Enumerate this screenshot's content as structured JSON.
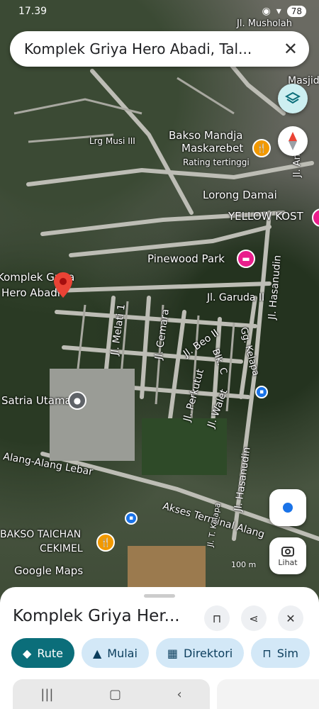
{
  "status": {
    "time": "17.39",
    "battery": "78"
  },
  "search": {
    "query": "Komplek Griya Hero Abadi, Tal..."
  },
  "map_labels": {
    "musholah": "Jl. Musholah",
    "masjid": "Masjid",
    "lrg_musi": "Lrg Musi III",
    "bakso_mandja_1": "Bakso Mandja",
    "bakso_mandja_2": "Maskarebet",
    "rating": "Rating tertinggi",
    "jl_anggu": "Jl. Anggu",
    "lorong_damai": "Lorong Damai",
    "yellow_kost": "YELLOW KOST",
    "pinewood": "Pinewood Park",
    "komplek_1": "Komplek Griya",
    "komplek_2": "Hero Abadi",
    "garuda": "Jl. Garuda II",
    "melati": "Jl. Melati 1",
    "cemara": "Jl. Cemara",
    "beo": "Jl. Beo II",
    "blk_c": "Blk. C",
    "kelapa": "Gg. Kelapa",
    "hasanudin_1": "Jl. Hasanudin",
    "perkutut": "Jl. Perkutut",
    "walet": "Jl. Walet",
    "satria": "Satria Utama",
    "alang": "Alang-Alang Lebar",
    "hasanudin_2": "Jl. Hasanudin",
    "akses": "Akses Terminal Alang",
    "bakso_taichan_1": "BAKSO TAICHAN",
    "bakso_taichan_2": "CEKIMEL",
    "google_maps": "Google Maps",
    "kelapa2": "Jl. T. Kelapa",
    "scale": "100 m"
  },
  "controls": {
    "lens_label": "Lihat"
  },
  "sheet": {
    "title": "Komplek Griya Her...",
    "chips": [
      "Rute",
      "Mulai",
      "Direktori",
      "Sim"
    ]
  },
  "colors": {
    "primary_chip": "#0b6e7a",
    "chip": "#d3e8f7",
    "pin": "#ea4335",
    "food_poi": "#f29900",
    "hotel_poi": "#e91e8c"
  }
}
